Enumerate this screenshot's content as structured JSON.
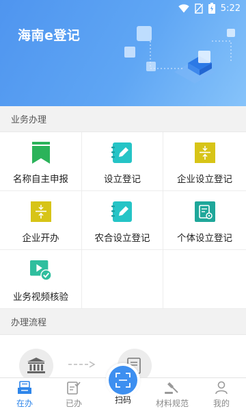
{
  "status_bar": {
    "time": "5:22"
  },
  "header": {
    "title": "海南e登记"
  },
  "sections": {
    "business": {
      "title": "业务办理",
      "items": [
        {
          "label": "名称自主申报",
          "icon": "bookmark-icon",
          "color": "#2bb35a"
        },
        {
          "label": "设立登记",
          "icon": "edit-note-icon",
          "color": "#25c4c6"
        },
        {
          "label": "企业设立登记",
          "icon": "collapse-icon",
          "color": "#d7c417"
        },
        {
          "label": "企业开办",
          "icon": "collapse-icon",
          "color": "#d7c417"
        },
        {
          "label": "农合设立登记",
          "icon": "edit-note-icon",
          "color": "#25c4c6"
        },
        {
          "label": "个体设立登记",
          "icon": "document-settings-icon",
          "color": "#1fa79a"
        },
        {
          "label": "业务视频核验",
          "icon": "video-check-icon",
          "color": "#2fbe9e"
        }
      ]
    },
    "process": {
      "title": "办理流程"
    }
  },
  "bottom_nav": {
    "items": [
      {
        "label": "在办",
        "icon": "in-progress-icon",
        "active": true
      },
      {
        "label": "已办",
        "icon": "done-icon",
        "active": false
      },
      {
        "label": "扫码",
        "icon": "scan-icon",
        "active": false
      },
      {
        "label": "材料规范",
        "icon": "gavel-icon",
        "active": false
      },
      {
        "label": "我的",
        "icon": "person-icon",
        "active": false
      }
    ]
  },
  "colors": {
    "accent": "#2f86ea",
    "header_start": "#4f95ef",
    "header_end": "#86c3fa"
  }
}
